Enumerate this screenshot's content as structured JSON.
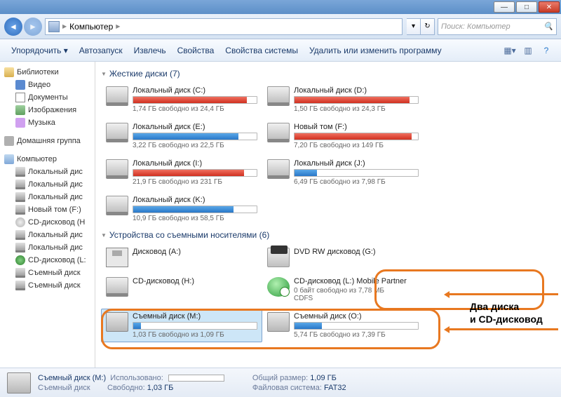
{
  "titlebar": {
    "minimize": "—",
    "maximize": "□",
    "close": "✕"
  },
  "nav": {
    "breadcrumb": "Компьютер",
    "sep": "▶",
    "search_placeholder": "Поиск: Компьютер"
  },
  "toolbar": {
    "organize": "Упорядочить ▾",
    "autorun": "Автозапуск",
    "extract": "Извлечь",
    "properties": "Свойства",
    "sysprops": "Свойства системы",
    "uninstall": "Удалить или изменить программу"
  },
  "sidebar": {
    "libraries": "Библиотеки",
    "video": "Видео",
    "documents": "Документы",
    "pictures": "Изображения",
    "music": "Музыка",
    "homegroup": "Домашняя группа",
    "computer": "Компьютер",
    "items": [
      "Локальный дис",
      "Локальный дис",
      "Локальный дис",
      "Новый том (F:)",
      "CD-дисковод (H",
      "Локальный дис",
      "Локальный дис",
      "CD-дисковод (L:",
      "Съемный диск",
      "Съемный диск"
    ]
  },
  "sections": {
    "hdd": {
      "title": "Жесткие диски (7)"
    },
    "removable": {
      "title": "Устройства со съемными носителями (6)"
    }
  },
  "drives": [
    {
      "name": "Локальный диск (C:)",
      "free": "1,74 ГБ свободно из 24,4 ГБ",
      "fill": 92,
      "color": "red"
    },
    {
      "name": "Локальный диск (D:)",
      "free": "1,50 ГБ свободно из 24,3 ГБ",
      "fill": 93,
      "color": "red"
    },
    {
      "name": "Локальный диск (E:)",
      "free": "3,22 ГБ свободно из 22,5 ГБ",
      "fill": 85,
      "color": "blue"
    },
    {
      "name": "Новый том (F:)",
      "free": "7,20 ГБ свободно из 149 ГБ",
      "fill": 95,
      "color": "red"
    },
    {
      "name": "Локальный диск (I:)",
      "free": "21,9 ГБ свободно из 231 ГБ",
      "fill": 90,
      "color": "red"
    },
    {
      "name": "Локальный диск (J:)",
      "free": "6,49 ГБ свободно из 7,98 ГБ",
      "fill": 18,
      "color": "blue"
    },
    {
      "name": "Локальный диск (K:)",
      "free": "10,9 ГБ свободно из 58,5 ГБ",
      "fill": 81,
      "color": "blue"
    }
  ],
  "removable": [
    {
      "type": "floppy",
      "name": "Дисковод (A:)"
    },
    {
      "type": "dvd",
      "name": "DVD RW дисковод (G:)"
    },
    {
      "type": "cd",
      "name": "CD-дисковод (H:)"
    },
    {
      "type": "cdg",
      "name": "CD-дисковод (L:) Mobile Partner",
      "free": "0 байт свободно из 7,78 МБ",
      "extra": "CDFS"
    },
    {
      "type": "usb",
      "name": "Съемный диск (M:)",
      "free": "1,03 ГБ свободно из 1,09 ГБ",
      "fill": 6,
      "selected": true
    },
    {
      "type": "usb",
      "name": "Съемный диск (O:)",
      "free": "5,74 ГБ свободно из 7,39 ГБ",
      "fill": 22
    }
  ],
  "annotation": {
    "text1": "Два диска",
    "text2": "и CD-дисковод"
  },
  "status": {
    "title": "Съемный диск (M:)",
    "used_lbl": "Использовано:",
    "type": "Съемный диск",
    "free_lbl": "Свободно:",
    "free_val": "1,03 ГБ",
    "total_lbl": "Общий размер:",
    "total_val": "1,09 ГБ",
    "fs_lbl": "Файловая система:",
    "fs_val": "FAT32"
  }
}
